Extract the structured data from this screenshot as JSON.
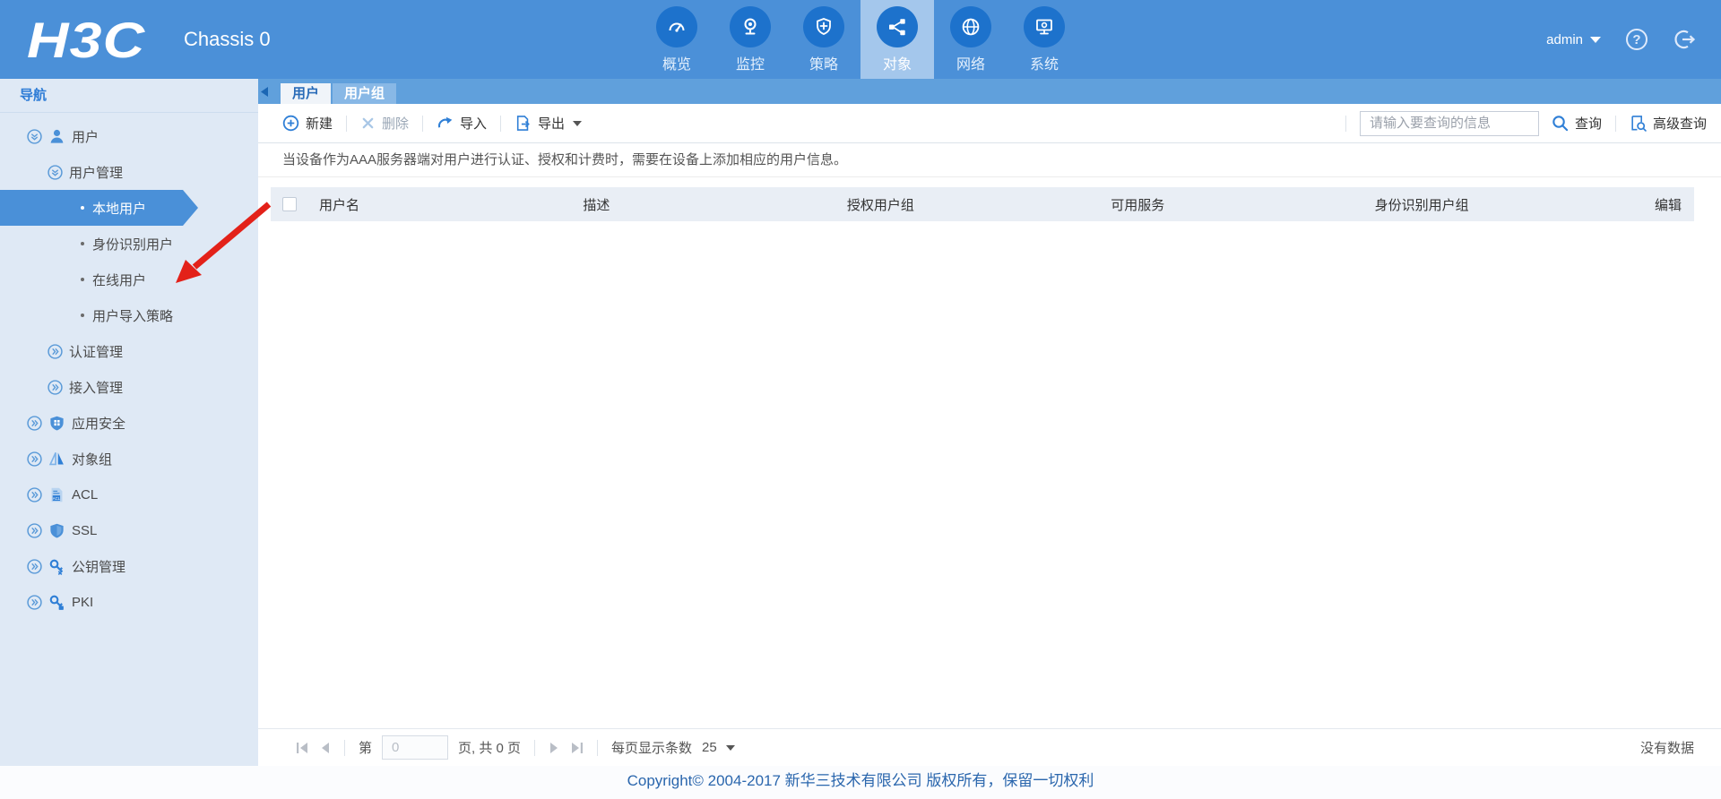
{
  "colors": {
    "header_blue": "#4b90d8",
    "icon_circle_blue": "#1d72cc",
    "active_nav_bg": "#a4c7ec",
    "tabbar_blue": "#60a0dc",
    "accent_blue": "#2f7fd6",
    "sidebar_bg": "#dfe9f5",
    "selected_nav_bg": "#4a90d8",
    "table_header_bg": "#e9eef5",
    "annotation_red": "#e32119",
    "footer_text_blue": "#2a66ad"
  },
  "header": {
    "logo": "H3C",
    "device_name": "Chassis 0",
    "nav_items": [
      {
        "label": "概览",
        "icon": "gauge-icon",
        "active": false
      },
      {
        "label": "监控",
        "icon": "camera-icon",
        "active": false
      },
      {
        "label": "策略",
        "icon": "shield-plus-icon",
        "active": false
      },
      {
        "label": "对象",
        "icon": "share-icon",
        "active": true
      },
      {
        "label": "网络",
        "icon": "globe-icon",
        "active": false
      },
      {
        "label": "系统",
        "icon": "monitor-icon",
        "active": false
      }
    ],
    "username": "admin"
  },
  "sidebar": {
    "title": "导航",
    "items": [
      {
        "label": "用户",
        "level": 1,
        "state": "expanded",
        "icon": "user-icon"
      },
      {
        "label": "用户管理",
        "level": 2,
        "state": "expanded"
      },
      {
        "label": "本地用户",
        "level": 3,
        "selected": true
      },
      {
        "label": "身份识别用户",
        "level": 3
      },
      {
        "label": "在线用户",
        "level": 3
      },
      {
        "label": "用户导入策略",
        "level": 3
      },
      {
        "label": "认证管理",
        "level": 2,
        "state": "collapsed"
      },
      {
        "label": "接入管理",
        "level": 2,
        "state": "collapsed"
      },
      {
        "label": "应用安全",
        "level": 1,
        "state": "collapsed",
        "icon": "app-security-shield-icon"
      },
      {
        "label": "对象组",
        "level": 1,
        "state": "collapsed",
        "icon": "object-group-icon"
      },
      {
        "label": "ACL",
        "level": 1,
        "state": "collapsed",
        "icon": "acl-document-icon"
      },
      {
        "label": "SSL",
        "level": 1,
        "state": "collapsed",
        "icon": "ssl-shield-icon"
      },
      {
        "label": "公钥管理",
        "level": 1,
        "state": "collapsed",
        "icon": "public-key-icon"
      },
      {
        "label": "PKI",
        "level": 1,
        "state": "collapsed",
        "icon": "pki-key-icon"
      }
    ]
  },
  "content": {
    "tabs": [
      {
        "label": "用户",
        "active": true
      },
      {
        "label": "用户组",
        "active": false
      }
    ],
    "toolbar": {
      "new_label": "新建",
      "delete_label": "删除",
      "import_label": "导入",
      "export_label": "导出",
      "search_placeholder": "请输入要查询的信息",
      "search_label": "查询",
      "advanced_search_label": "高级查询"
    },
    "info_text": "当设备作为AAA服务器端对用户进行认证、授权和计费时，需要在设备上添加相应的用户信息。",
    "table": {
      "columns": [
        "用户名",
        "描述",
        "授权用户组",
        "可用服务",
        "身份识别用户组",
        "编辑"
      ],
      "rows": []
    },
    "pagination": {
      "page_label": "第",
      "page_value": "0",
      "total_label": "页, 共 0 页",
      "per_page_label": "每页显示条数",
      "per_page_value": "25",
      "empty_text": "没有数据"
    }
  },
  "footer": {
    "copyright": "Copyright© 2004-2017 新华三技术有限公司 版权所有，保留一切权利"
  }
}
